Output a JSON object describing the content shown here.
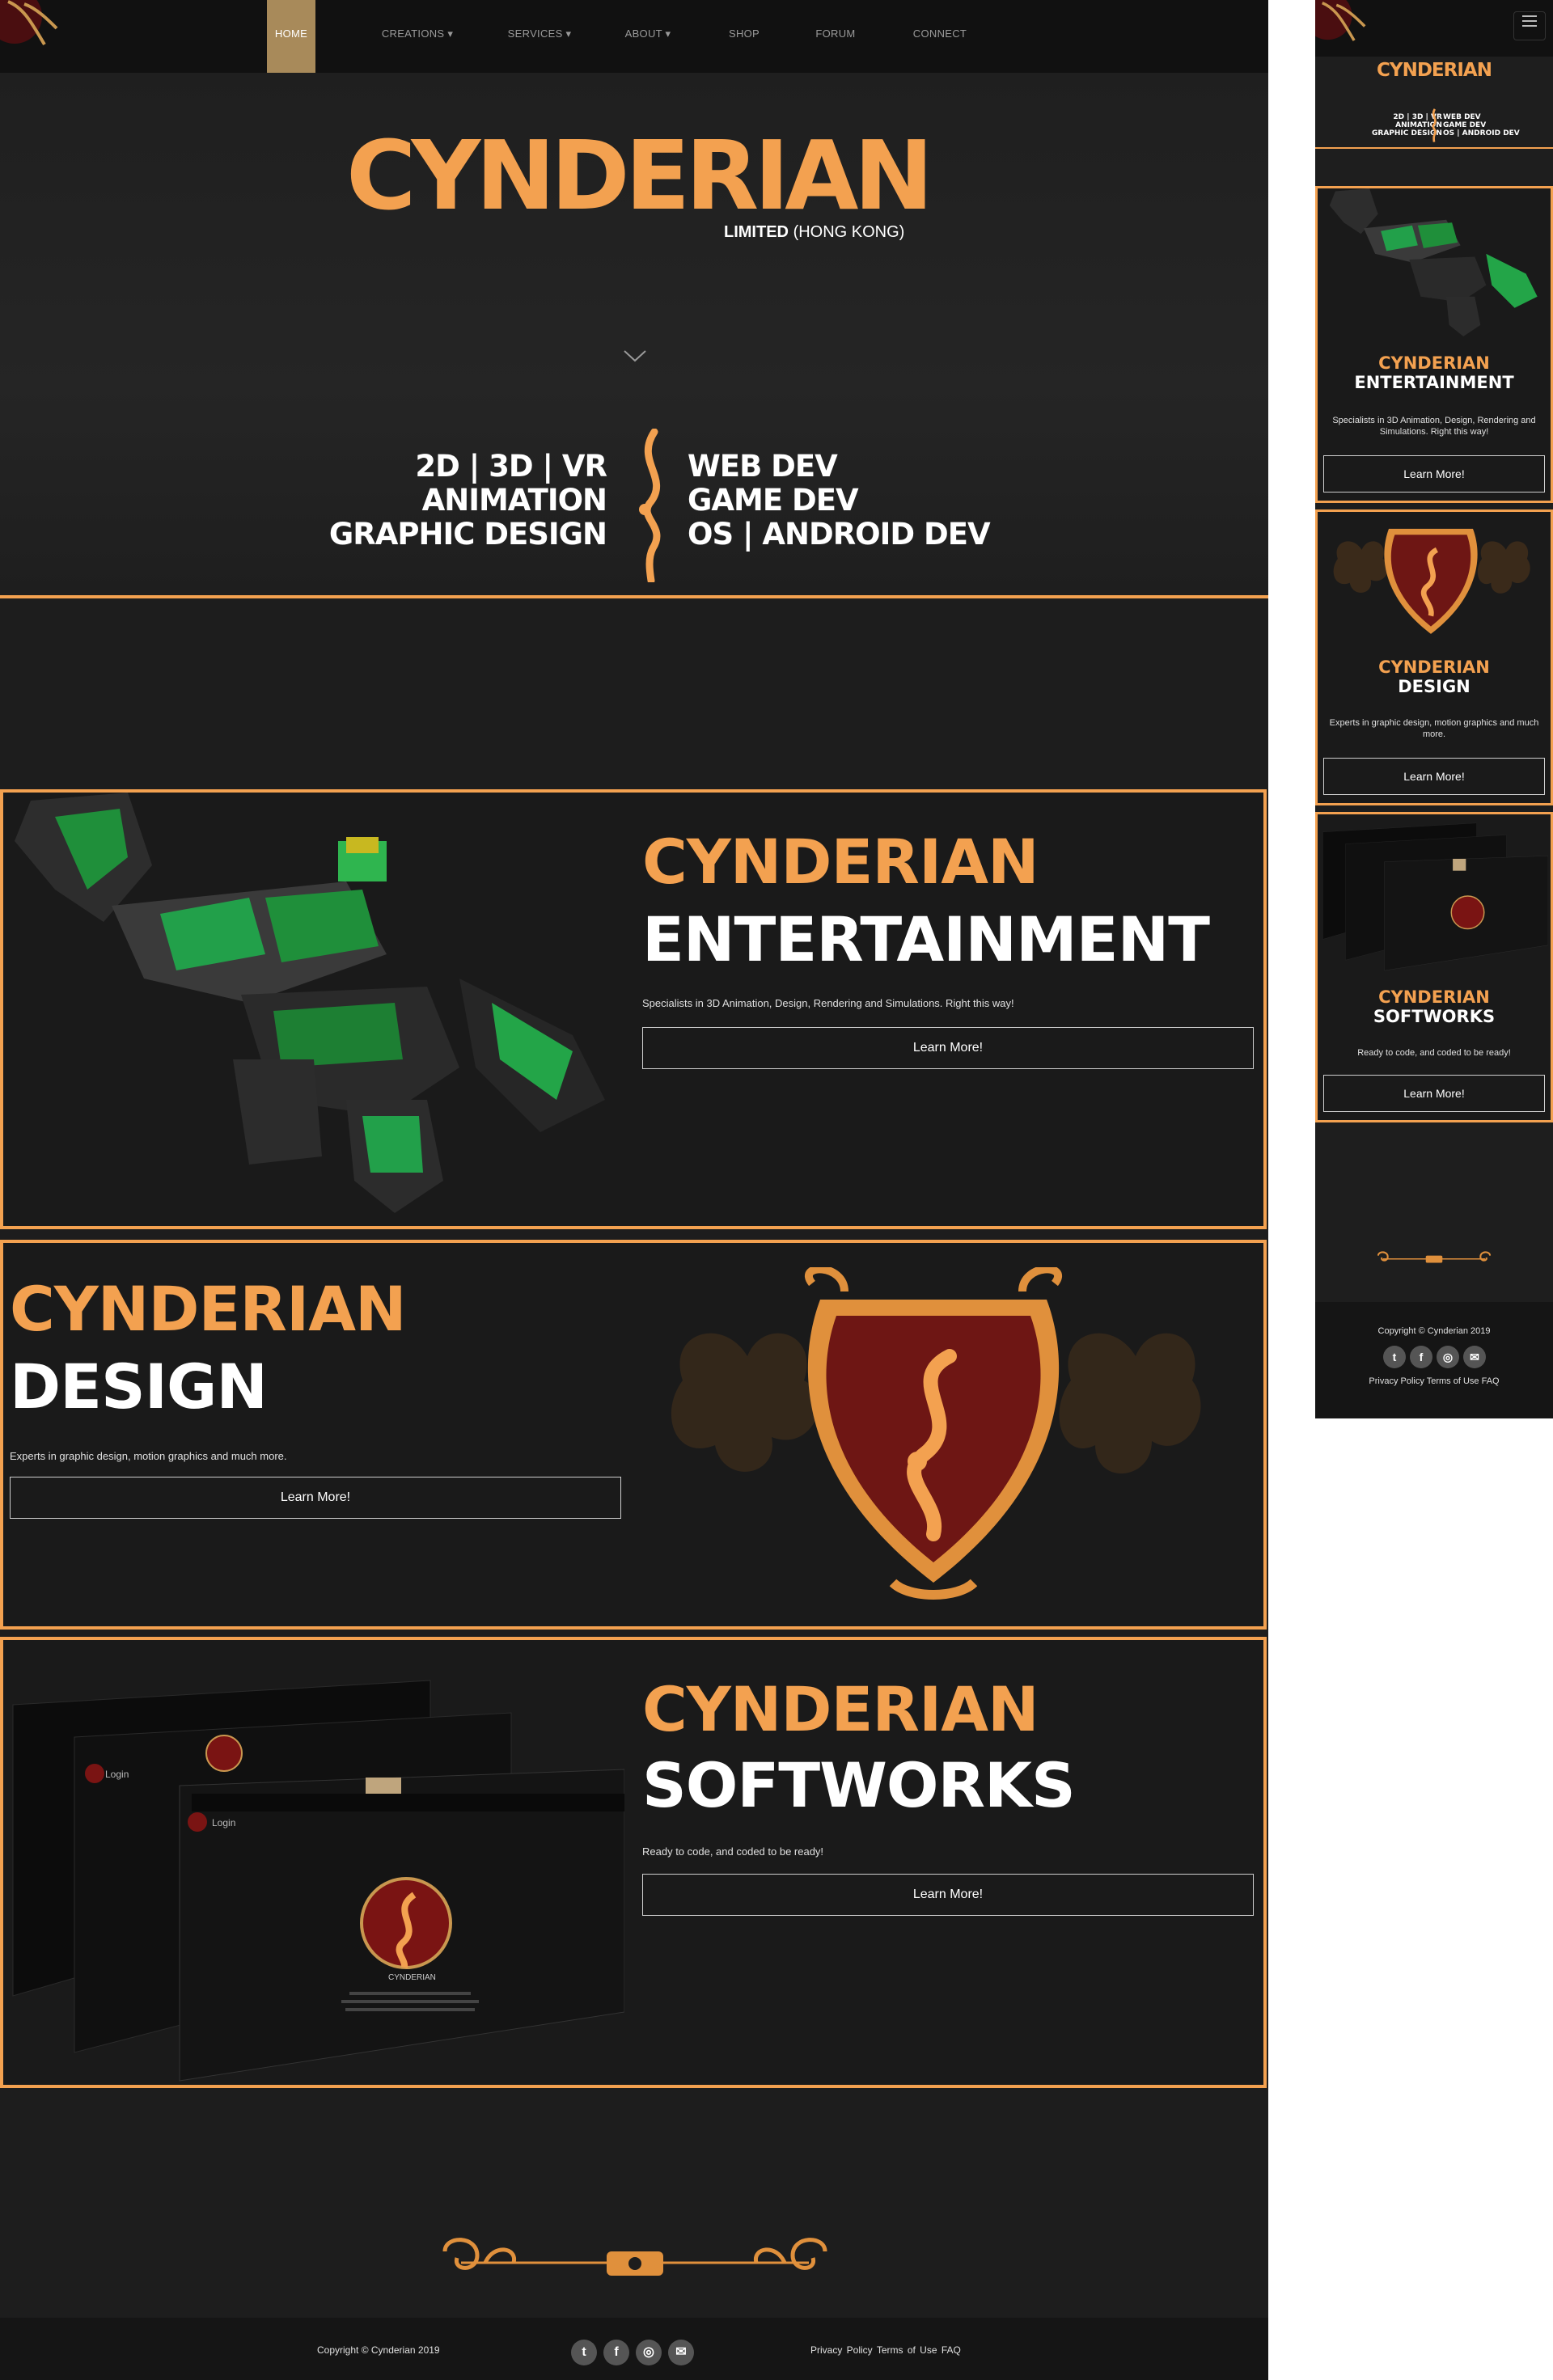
{
  "nav": {
    "items": [
      {
        "label": "HOME"
      },
      {
        "label": "CREATIONS ▾"
      },
      {
        "label": "SERVICES ▾"
      },
      {
        "label": "ABOUT ▾"
      },
      {
        "label": "SHOP"
      },
      {
        "label": "FORUM"
      },
      {
        "label": "CONNECT"
      }
    ],
    "active_index": 0
  },
  "hero": {
    "brand": "CYNDERIAN",
    "sub_bold": "LIMITED",
    "sub_light": "(HONG KONG)",
    "tagline_left": [
      "2D | 3D | VR",
      "ANIMATION",
      "GRAPHIC DESIGN"
    ],
    "tagline_right": [
      "WEB DEV",
      "GAME DEV",
      "OS | ANDROID DEV"
    ]
  },
  "sections": [
    {
      "title_top": "CYNDERIAN",
      "title_bottom": "ENTERTAINMENT",
      "description": "Specialists in 3D Animation, Design, Rendering and Simulations. Right this way!",
      "button": "Learn More!"
    },
    {
      "title_top": "CYNDERIAN",
      "title_bottom": "DESIGN",
      "description": "Experts in graphic design, motion graphics and much more.",
      "button": "Learn More!"
    },
    {
      "title_top": "CYNDERIAN",
      "title_bottom": "SOFTWORKS",
      "description": "Ready to code, and coded to be ready!",
      "button": "Learn More!"
    }
  ],
  "mockup": {
    "login": "Login",
    "caption": "CYNDERIAN"
  },
  "footer": {
    "copyright": "Copyright © Cynderian 2019",
    "social": [
      {
        "icon": "twitter-icon",
        "glyph": "t"
      },
      {
        "icon": "facebook-icon",
        "glyph": "f"
      },
      {
        "icon": "instagram-icon",
        "glyph": "◎"
      },
      {
        "icon": "email-icon",
        "glyph": "✉"
      }
    ],
    "links": [
      "Privacy Policy",
      "Terms of Use",
      "FAQ"
    ]
  },
  "mobile": {
    "brand": "CYNDERIAN",
    "tagline_left": [
      "2D | 3D | VR",
      "ANIMATION",
      "GRAPHIC DESIGN"
    ],
    "tagline_right": [
      "WEB DEV",
      "GAME DEV",
      "OS | ANDROID DEV"
    ],
    "sections": [
      {
        "title_top": "CYNDERIAN",
        "title_bottom": "ENTERTAINMENT",
        "description": "Specialists in 3D Animation, Design, Rendering and Simulations. Right this way!",
        "button": "Learn More!"
      },
      {
        "title_top": "CYNDERIAN",
        "title_bottom": "DESIGN",
        "description": "Experts in graphic design, motion graphics and much more.",
        "button": "Learn More!"
      },
      {
        "title_top": "CYNDERIAN",
        "title_bottom": "SOFTWORKS",
        "description": "Ready to code, and coded to be ready!",
        "button": "Learn More!"
      }
    ],
    "copyright": "Copyright © Cynderian 2019",
    "links": [
      "Privacy Policy",
      "Terms of Use",
      "FAQ"
    ]
  },
  "colors": {
    "accent": "#f3a150",
    "background": "#1d1d1d",
    "nav_active": "#a88a5a"
  }
}
